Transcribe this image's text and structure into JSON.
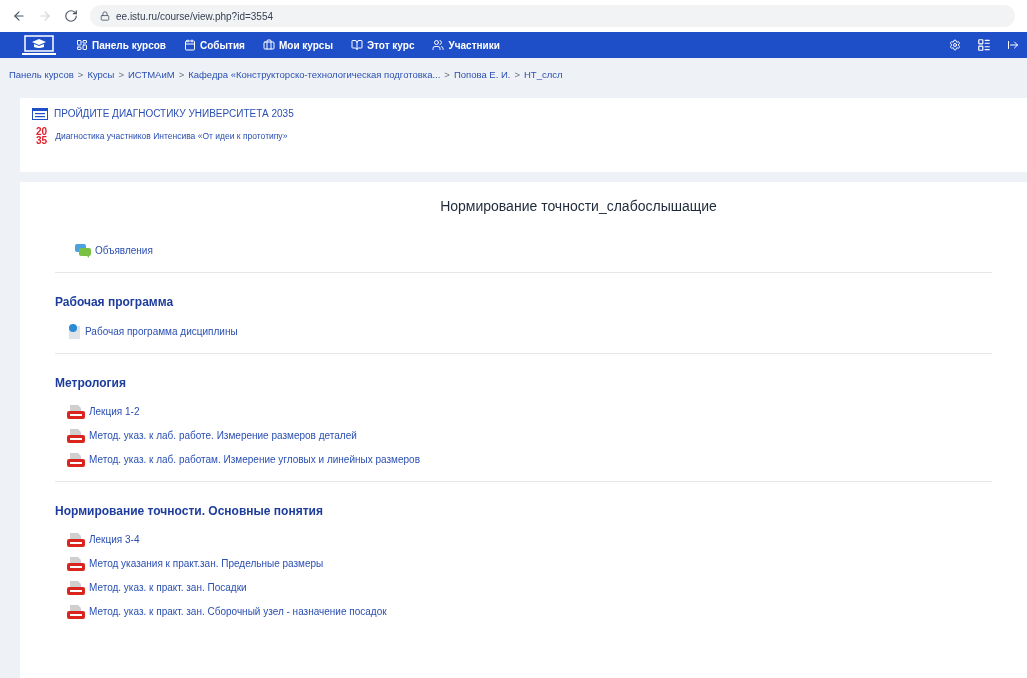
{
  "browser": {
    "url": "ee.istu.ru/course/view.php?id=3554"
  },
  "nav": {
    "items": [
      {
        "label": "Панель курсов",
        "kind": "dashboard"
      },
      {
        "label": "События",
        "kind": "calendar"
      },
      {
        "label": "Мои курсы",
        "kind": "briefcase"
      },
      {
        "label": "Этот курс",
        "kind": "book"
      },
      {
        "label": "Участники",
        "kind": "users"
      }
    ]
  },
  "breadcrumb": [
    "Панель курсов",
    "Курсы",
    "ИСТМАиМ",
    "Кафедра «Конструкторско-технологическая подготовка...",
    "Попова Е. И.",
    "НТ_слсл"
  ],
  "breadcrumb_separator": ">",
  "diagnostic": {
    "heading": "ПРОЙДИТЕ ДИАГНОСТИКУ УНИВЕРСИТЕТА 2035",
    "logo_lines": [
      "20",
      "35"
    ],
    "link": "Диагностика участников Интенсива «От идеи к прототипу»"
  },
  "course": {
    "title": "Нормирование точности_слабослышащие",
    "top_items": [
      {
        "label": "Объявления",
        "kind": "forum"
      }
    ],
    "sections": [
      {
        "title": "Рабочая программа",
        "items": [
          {
            "label": "Рабочая программа дисциплины",
            "kind": "url"
          }
        ]
      },
      {
        "title": "Метрология",
        "items": [
          {
            "label": "Лекция 1-2",
            "kind": "pdf"
          },
          {
            "label": "Метод. указ. к лаб. работе. Измерение размеров деталей",
            "kind": "pdf"
          },
          {
            "label": "Метод. указ. к лаб. работам. Измерение угловых и линейных размеров",
            "kind": "pdf"
          }
        ]
      },
      {
        "title": "Нормирование точности. Основные понятия",
        "items": [
          {
            "label": "Лекция 3-4",
            "kind": "pdf"
          },
          {
            "label": "Метод указания к практ.зан. Предельные размеры",
            "kind": "pdf"
          },
          {
            "label": "Метод. указ. к практ. зан. Посадки",
            "kind": "pdf"
          },
          {
            "label": "Метод. указ. к практ. зан. Сборочный узел - назначение посадок",
            "kind": "pdf"
          }
        ]
      }
    ]
  }
}
